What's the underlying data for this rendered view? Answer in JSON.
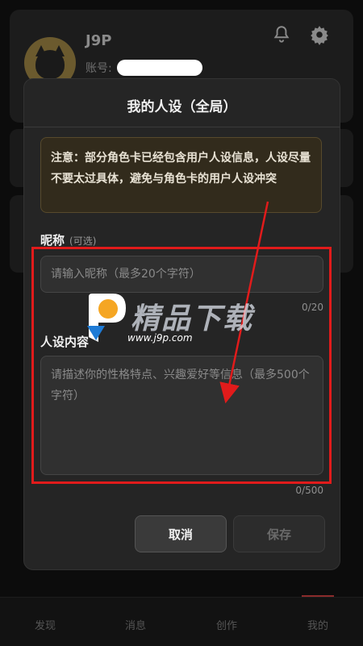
{
  "background": {
    "username": "J9P",
    "account_label": "账号:",
    "tabs": [
      "发现",
      "消息",
      "创作",
      "我的"
    ]
  },
  "modal": {
    "title": "我的人设（全局）",
    "notice": "注意：部分角色卡已经包含用户人设信息，人设尽量不要太过具体，避免与角色卡的用户人设冲突",
    "nickname": {
      "label": "昵称",
      "hint": "(可选)",
      "placeholder": "请输入昵称（最多20个字符）",
      "value": "",
      "counter": "0/20"
    },
    "persona": {
      "label": "人设内容",
      "placeholder": "请描述你的性格特点、兴趣爱好等信息（最多500个字符）",
      "value": "",
      "counter": "0/500"
    },
    "cancel_label": "取消",
    "save_label": "保存"
  },
  "watermark": {
    "brand": "精品下载",
    "url": "www.j9p.com"
  },
  "colors": {
    "accent_red": "#e11b1b",
    "notice_bg": "#322b1c",
    "modal_bg": "#252525"
  }
}
